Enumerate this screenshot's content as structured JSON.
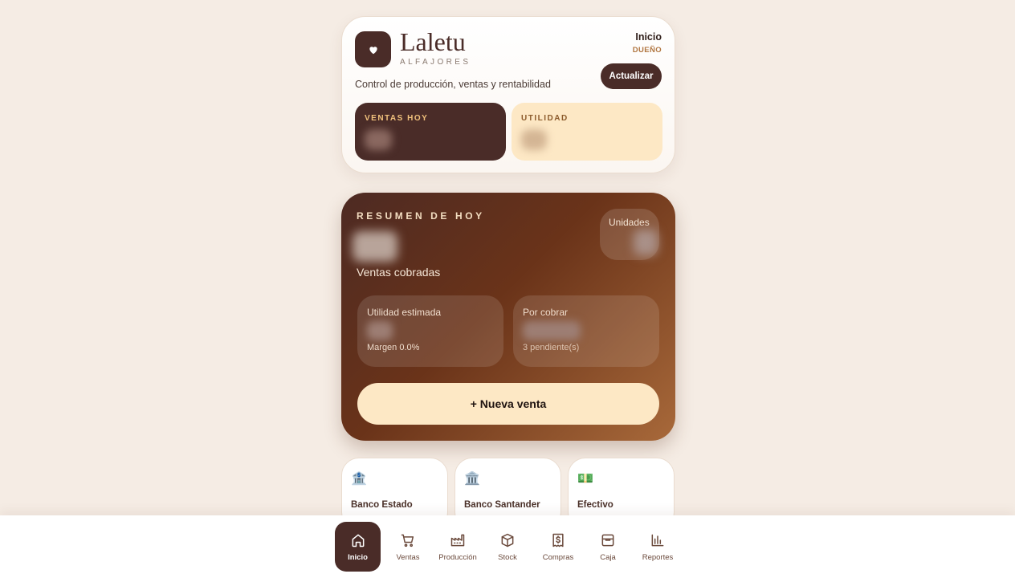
{
  "header": {
    "brand_name": "Laletu",
    "brand_sub": "ALFAJORES",
    "subtitle": "Control de producción, ventas y rentabilidad",
    "user_name": "Inicio",
    "user_role": "DUEÑO",
    "refresh_label": "Actualizar",
    "stats": [
      {
        "label": "VENTAS HOY"
      },
      {
        "label": "UTILIDAD"
      }
    ]
  },
  "summary": {
    "title": "RESUMEN DE HOY",
    "main_label": "Ventas cobradas",
    "units_label": "Unidades",
    "profit_label": "Utilidad estimada",
    "profit_margin": "Margen 0.0%",
    "receivable_label": "Por cobrar",
    "receivable_foot": "3 pendiente(s)",
    "new_sale_label": "+ Nueva venta"
  },
  "accounts": [
    {
      "icon": "bank-icon",
      "glyph": "🏦",
      "name": "Banco Estado"
    },
    {
      "icon": "bank-icon",
      "glyph": "🏛️",
      "name": "Banco Santander"
    },
    {
      "icon": "cash-icon",
      "glyph": "💵",
      "name": "Efectivo"
    }
  ],
  "nav": [
    {
      "label": "Inicio",
      "icon": "home-icon",
      "active": true
    },
    {
      "label": "Ventas",
      "icon": "cart-icon"
    },
    {
      "label": "Producción",
      "icon": "factory-icon"
    },
    {
      "label": "Stock",
      "icon": "box-icon"
    },
    {
      "label": "Compras",
      "icon": "receipt-icon"
    },
    {
      "label": "Caja",
      "icon": "inbox-icon"
    },
    {
      "label": "Reportes",
      "icon": "bar-chart-icon"
    }
  ],
  "colors": {
    "background": "#f5ece4",
    "primary": "#4a2c28",
    "cream": "#fde8c5",
    "accent": "#b0753f"
  }
}
